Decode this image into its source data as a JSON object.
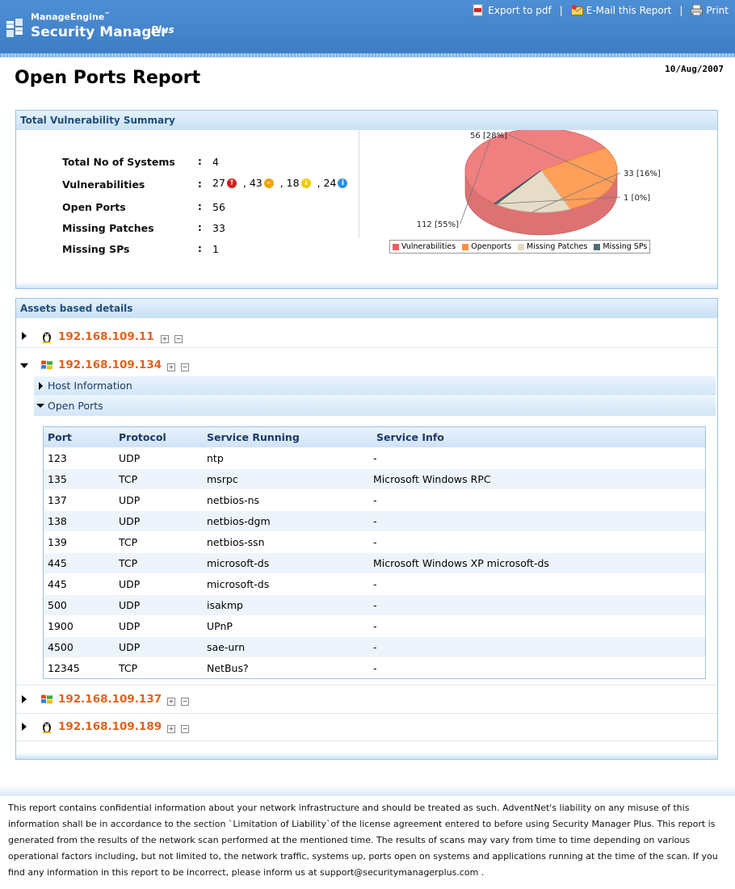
{
  "header": {
    "brand_small": "ManageEngine",
    "brand_tm": "™",
    "brand_big": "Security Manager",
    "brand_plus": "Plus",
    "links": {
      "pdf": "Export to pdf",
      "email": "E-Mail this Report",
      "print": "Print",
      "separator": "|"
    }
  },
  "report": {
    "title": "Open Ports Report",
    "date": "10/Aug/2007"
  },
  "summary": {
    "heading": "Total Vulnerability Summary",
    "rows": {
      "systems_label": "Total No of Systems",
      "systems_value": "4",
      "vuln_label": "Vulnerabilities",
      "vuln_high": "27",
      "vuln_medium": ", 43",
      "vuln_low": ", 18",
      "vuln_info": ", 24",
      "ports_label": "Open Ports",
      "ports_value": "56",
      "patches_label": "Missing Patches",
      "patches_value": "33",
      "sps_label": "Missing SPs",
      "sps_value": "1",
      "colon": ":"
    }
  },
  "chart_data": {
    "type": "pie",
    "categories": [
      "Vulnerabilities",
      "Openports",
      "Missing Patches",
      "Missing SPs"
    ],
    "values": [
      112,
      56,
      33,
      1
    ],
    "labels": [
      "112 [55%]",
      "56 [28%]",
      "33 [16%]",
      "1 [0%]"
    ],
    "colors": [
      "#f08080",
      "#ff9f5a",
      "#e6dcc8",
      "#4f6e78"
    ],
    "legend_position": "bottom"
  },
  "assets": {
    "heading": "Assets based details",
    "hosts": [
      {
        "ip": "192.168.109.11",
        "os": "linux-icon"
      },
      {
        "ip": "192.168.109.134",
        "os": "windows-icon"
      },
      {
        "ip": "192.168.109.137",
        "os": "windows-icon"
      },
      {
        "ip": "192.168.109.189",
        "os": "linux-icon"
      }
    ],
    "expanded": {
      "host_info": "Host Information",
      "open_ports": "Open Ports",
      "columns": [
        "Port",
        "Protocol",
        "Service Running",
        "Service Info"
      ],
      "rows": [
        [
          "123",
          "UDP",
          "ntp",
          "-"
        ],
        [
          "135",
          "TCP",
          "msrpc",
          "Microsoft Windows RPC"
        ],
        [
          "137",
          "UDP",
          "netbios-ns",
          "-"
        ],
        [
          "138",
          "UDP",
          "netbios-dgm",
          "-"
        ],
        [
          "139",
          "TCP",
          "netbios-ssn",
          "-"
        ],
        [
          "445",
          "TCP",
          "microsoft-ds",
          "Microsoft Windows XP microsoft-ds"
        ],
        [
          "445",
          "UDP",
          "microsoft-ds",
          "-"
        ],
        [
          "500",
          "UDP",
          "isakmp",
          "-"
        ],
        [
          "1900",
          "UDP",
          "UPnP",
          "-"
        ],
        [
          "4500",
          "UDP",
          "sae-urn",
          "-"
        ],
        [
          "12345",
          "TCP",
          "NetBus?",
          "-"
        ]
      ]
    }
  },
  "disclaimer": "This report contains confidential information about your network infrastructure and should be treated as such. AdventNet's liability on any misuse of this information shall be in accordance to the section `Limitation of Liability`of the license agreement entered to before using Security Manager Plus. This report is generated from the results of the network scan performed at the mentioned time. The results of scans may vary from time to time depending on various operational factors including, but not limited to, the network traffic, systems up, ports open on systems and applications running at the time of the scan. If you find any information in this report to be incorrect, please inform us at support@securitymanagerplus.com ."
}
